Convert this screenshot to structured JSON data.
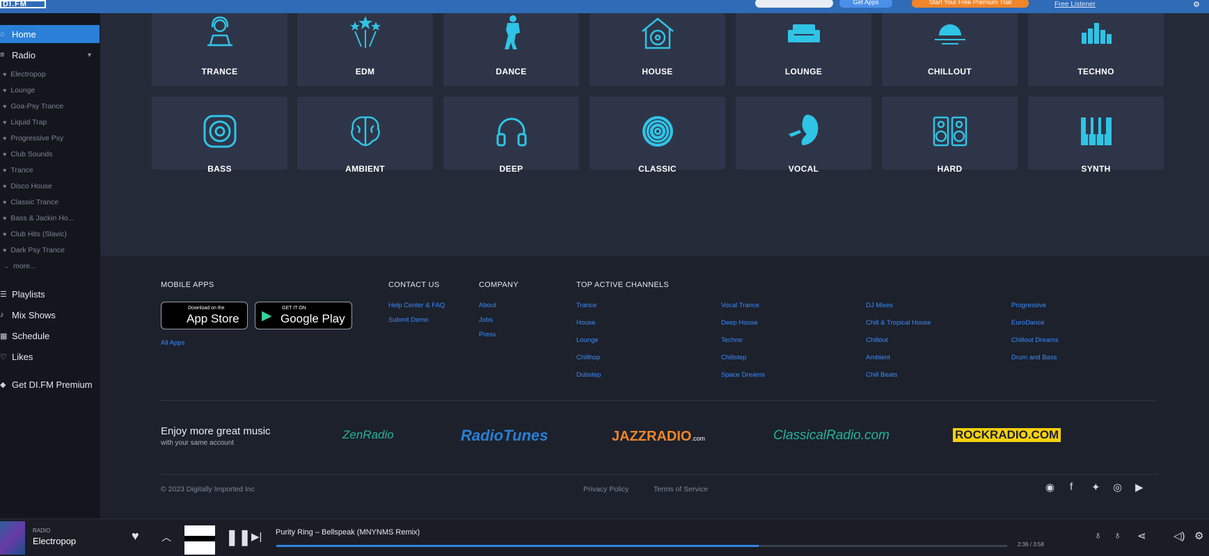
{
  "topbar": {
    "logo": "DI.FM",
    "get_apps": "Get Apps",
    "free_trial": "Start Your Free Premium Trial",
    "free_listener": "Free Listener"
  },
  "sidebar": {
    "home": "Home",
    "radio": "Radio",
    "channels": [
      "Electropop",
      "Lounge",
      "Goa-Psy Trance",
      "Liquid Trap",
      "Progressive Psy",
      "Club Sounds",
      "Trance",
      "Disco House",
      "Classic Trance",
      "Bass & Jackin Ho...",
      "Club Hits (Slavic)",
      "Dark Psy Trance"
    ],
    "more": "more...",
    "playlists": "Playlists",
    "mix_shows": "Mix Shows",
    "schedule": "Schedule",
    "likes": "Likes",
    "premium": "Get DI.FM Premium"
  },
  "genres": [
    {
      "label": "TRANCE",
      "icon": "dj-headphones-icon"
    },
    {
      "label": "EDM",
      "icon": "stars-icon"
    },
    {
      "label": "DANCE",
      "icon": "dancer-icon"
    },
    {
      "label": "HOUSE",
      "icon": "house-vinyl-icon"
    },
    {
      "label": "LOUNGE",
      "icon": "sofa-icon"
    },
    {
      "label": "CHILLOUT",
      "icon": "sunset-icon"
    },
    {
      "label": "TECHNO",
      "icon": "equalizer-icon"
    },
    {
      "label": "BASS",
      "icon": "speaker-icon"
    },
    {
      "label": "AMBIENT",
      "icon": "brain-icon"
    },
    {
      "label": "DEEP",
      "icon": "headphones-icon"
    },
    {
      "label": "CLASSIC",
      "icon": "vinyl-icon"
    },
    {
      "label": "VOCAL",
      "icon": "singer-icon"
    },
    {
      "label": "HARD",
      "icon": "speakers-icon"
    },
    {
      "label": "SYNTH",
      "icon": "keyboard-icon"
    }
  ],
  "footer": {
    "mobile_apps": "MOBILE APPS",
    "app_store_small": "Download on the",
    "app_store_big": "App Store",
    "google_play_small": "GET IT ON",
    "google_play_big": "Google Play",
    "all_apps": "All Apps",
    "contact_us": "CONTACT US",
    "contact_links": [
      "Help Center & FAQ",
      "Submit Demo"
    ],
    "company": "COMPANY",
    "company_links": [
      "About",
      "Jobs",
      "Press"
    ],
    "top_channels": "TOP ACTIVE CHANNELS",
    "channel_cols": [
      [
        "Trance",
        "House",
        "Lounge",
        "Chillhop",
        "Dubstep"
      ],
      [
        "Vocal Trance",
        "Deep House",
        "Techno",
        "Chillstep",
        "Space Dreams"
      ],
      [
        "DJ Mixes",
        "Chill & Tropical House",
        "Chillout",
        "Ambient",
        "Chill Beats"
      ],
      [
        "Progressive",
        "EuroDance",
        "Chillout Dreams",
        "Drum and Bass"
      ]
    ],
    "enjoy_title": "Enjoy more great music",
    "enjoy_sub": "with your same account",
    "brands": [
      "ZenRadio",
      "RadioTunes",
      "JAZZRADIO",
      ".com",
      "ClassicalRadio.com",
      "ROCKRADIO.COM"
    ],
    "copyright": "© 2023 Digitally Imported Inc",
    "privacy": "Privacy Policy",
    "terms": "Terms of Service",
    "social_icons": [
      "discord-icon",
      "facebook-icon",
      "twitter-icon",
      "instagram-icon",
      "youtube-icon"
    ]
  },
  "player": {
    "type": "RADIO",
    "channel": "Electropop",
    "track": "Purity Ring – Bellspeak (MNYNMS Remix)",
    "time": "2:36 / 3:58",
    "progress": 0.66
  }
}
